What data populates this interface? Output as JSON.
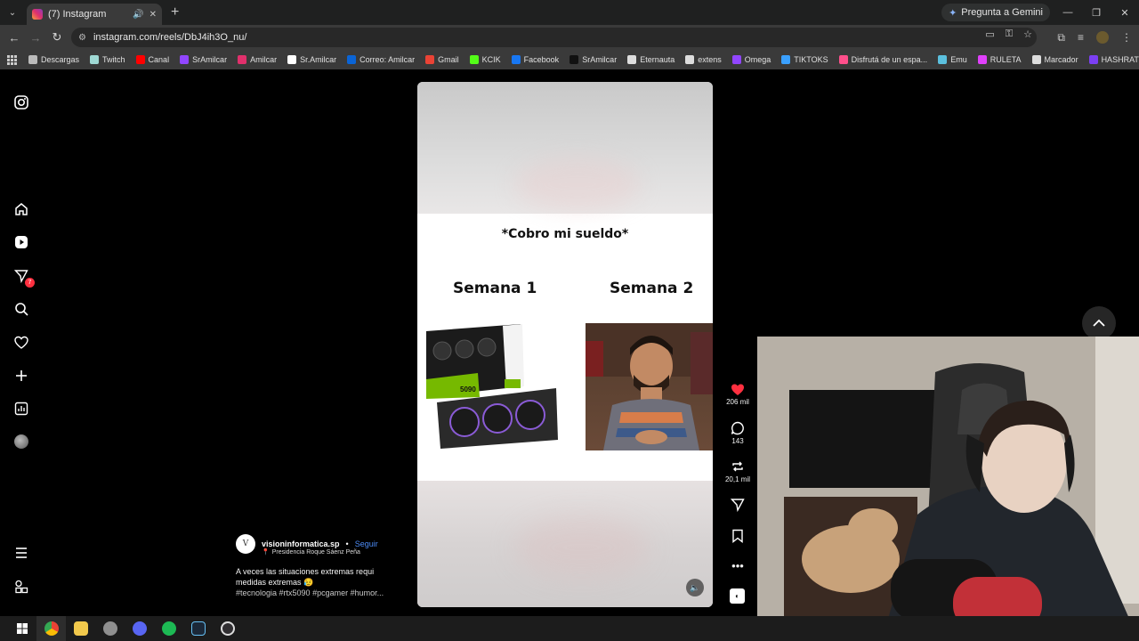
{
  "browser": {
    "tab": {
      "title": "(7) Instagram"
    },
    "gemini_label": "Pregunta a Gemini",
    "url": "instagram.com/reels/DbJ4ih3O_nu/"
  },
  "bookmarks": [
    {
      "label": "Descargas",
      "color": "#bbbbbb"
    },
    {
      "label": "Twitch",
      "color": "#9fd9d4"
    },
    {
      "label": "Canal",
      "color": "#ff0000"
    },
    {
      "label": "SrAmilcar",
      "color": "#9146ff"
    },
    {
      "label": "Amilcar",
      "color": "#e1306c"
    },
    {
      "label": "Sr.Amilcar",
      "color": "#ffffff"
    },
    {
      "label": "Correo: Amilcar",
      "color": "#0a64d6"
    },
    {
      "label": "Gmail",
      "color": "#ea4335"
    },
    {
      "label": "KCIK",
      "color": "#53fc18"
    },
    {
      "label": "Facebook",
      "color": "#1877f2"
    },
    {
      "label": "SrAmilcar",
      "color": "#111111"
    },
    {
      "label": "Eternauta",
      "color": "#dddddd"
    },
    {
      "label": "extens",
      "color": "#dddddd"
    },
    {
      "label": "Omega",
      "color": "#9146ff"
    },
    {
      "label": "TIKTOKS",
      "color": "#3aa0ff"
    },
    {
      "label": "Disfrutá de un espa...",
      "color": "#ff4f8b"
    },
    {
      "label": "Emu",
      "color": "#5bc0de"
    },
    {
      "label": "RULETA",
      "color": "#e040fb"
    },
    {
      "label": "Marcador",
      "color": "#dddddd"
    },
    {
      "label": "HASHRATE AGENCY",
      "color": "#7b3ff2"
    }
  ],
  "sidebar": {
    "notifications_badge": "7"
  },
  "reel": {
    "caption_top": "*Cobro mi sueldo*",
    "week1": "Semana 1",
    "week2": "Semana 2",
    "gpu_text": "5090"
  },
  "actions": {
    "likes": "206 mil",
    "comments": "143",
    "reposts": "20,1 mil"
  },
  "post": {
    "author": "visioninformatica.sp",
    "separator": "•",
    "follow_label": "Seguir",
    "location": "Presidencia Roque Sáenz Peña",
    "description": "A veces las situaciones extremas requi medidas extremas 😥",
    "hashtags": "#tecnologia #rtx5090 #pcgamer #humor..."
  },
  "colors": {
    "like": "#ff3040",
    "follow": "#4c8bf5"
  }
}
